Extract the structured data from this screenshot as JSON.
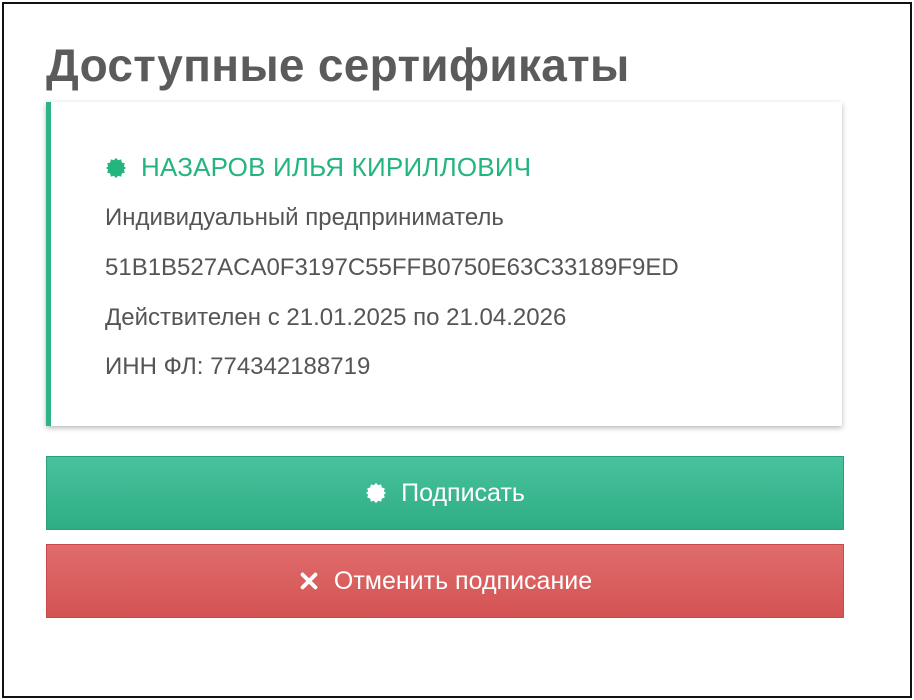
{
  "page": {
    "title": "Доступные сертификаты"
  },
  "certificate": {
    "owner_name": "НАЗАРОВ ИЛЬЯ КИРИЛЛОВИЧ",
    "owner_type": "Индивидуальный предприниматель",
    "serial": "51B1B527ACA0F3197C55FFB0750E63C33189F9ED",
    "validity": "Действителен с 21.01.2025 по 21.04.2026",
    "inn": "ИНН ФЛ: 774342188719",
    "icon": "seal-icon",
    "accent_color": "#2fb285"
  },
  "actions": {
    "sign_label": "Подписать",
    "sign_icon": "seal-icon",
    "sign_color": "#3bb890",
    "cancel_label": "Отменить подписание",
    "cancel_icon": "close-icon",
    "cancel_color": "#da5f5f"
  }
}
